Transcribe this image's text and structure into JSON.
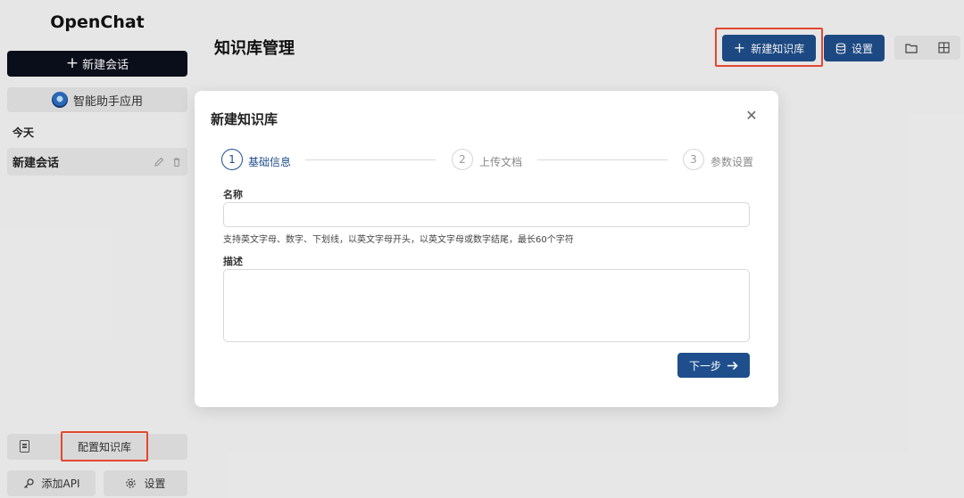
{
  "app": {
    "brand": "OpenChat"
  },
  "sidebar": {
    "new_chat_label": "新建会话",
    "assistant_label": "智能助手应用",
    "section_today": "今天",
    "conversations": [
      {
        "label": "新建会话"
      }
    ],
    "kb_config_label": "配置知识库",
    "add_api_label": "添加API",
    "settings_label": "设置"
  },
  "header": {
    "title": "知识库管理",
    "new_kb_label": "新建知识库",
    "settings_label": "设置"
  },
  "modal": {
    "title": "新建知识库",
    "steps": [
      {
        "number": "1",
        "label": "基础信息",
        "active": true
      },
      {
        "number": "2",
        "label": "上传文档",
        "active": false
      },
      {
        "number": "3",
        "label": "参数设置",
        "active": false
      }
    ],
    "name_label": "名称",
    "name_value": "",
    "name_hint": "支持英文字母、数字、下划线，以英文字母开头，以英文字母或数字结尾，最长60个字符",
    "desc_label": "描述",
    "desc_value": "",
    "next_label": "下一步"
  },
  "colors": {
    "primary": "#1f4e8c",
    "highlight": "#e4472f",
    "sidebar_dark": "#0b0f1c"
  }
}
